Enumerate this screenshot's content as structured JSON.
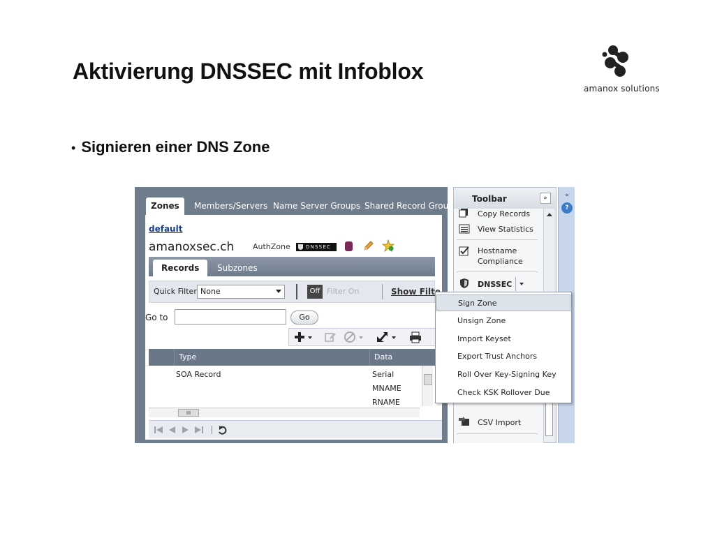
{
  "slide": {
    "title": "Aktivierung DNSSEC mit Infoblox",
    "bullet": "Signieren einer DNS Zone",
    "bullet_marker": "•",
    "logo_text": "amanox solutions"
  },
  "app": {
    "tabs": [
      "Zones",
      "Members/Servers",
      "Name Server Groups",
      "Shared Record Grou"
    ],
    "active_tab": "Zones",
    "breadcrumb_link": "default",
    "zone_name": "amanoxsec.ch",
    "zone_type": "AuthZone",
    "dnssec_badge": "DNSSEC",
    "subtabs": [
      "Records",
      "Subzones"
    ],
    "active_subtab": "Records",
    "filter": {
      "quick_filter_label": "Quick Filter",
      "quick_filter_value": "None",
      "off_label": "Off",
      "filter_on_label": "Filter On",
      "show_filter_label": "Show Filte"
    },
    "goto": {
      "label": "Go to",
      "value": "",
      "button": "Go"
    },
    "grid": {
      "columns": [
        "Type",
        "Data"
      ],
      "rows": [
        {
          "type": "SOA Record",
          "data": "Serial"
        },
        {
          "type": "",
          "data": "MNAME"
        },
        {
          "type": "",
          "data": "RNAME"
        }
      ],
      "scroll_thumb": "III"
    }
  },
  "sidebar": {
    "title": "Toolbar",
    "collapse_label": "»",
    "items": [
      {
        "label": "Copy Records",
        "icon": "copy-records-icon"
      },
      {
        "label": "View Statistics",
        "icon": "statistics-icon"
      },
      {
        "label": "Hostname",
        "label2": "Compliance",
        "icon": "checkbox-icon"
      },
      {
        "label": "DNSSEC",
        "icon": "shield-icon"
      },
      {
        "label": "CSV Import",
        "icon": "csv-import-icon"
      }
    ]
  },
  "far_right": {
    "collapse_label": "«",
    "help_label": "?"
  },
  "dnssec_menu": {
    "items": [
      "Sign Zone",
      "Unsign Zone",
      "Import Keyset",
      "Export Trust Anchors",
      "Roll Over Key-Signing Key",
      "Check KSK Rollover Due"
    ],
    "selected": "Sign Zone"
  },
  "colors": {
    "panel_header": "#6f7c8c",
    "link": "#1a3f8c",
    "menu_selected": "#dde3eb"
  }
}
